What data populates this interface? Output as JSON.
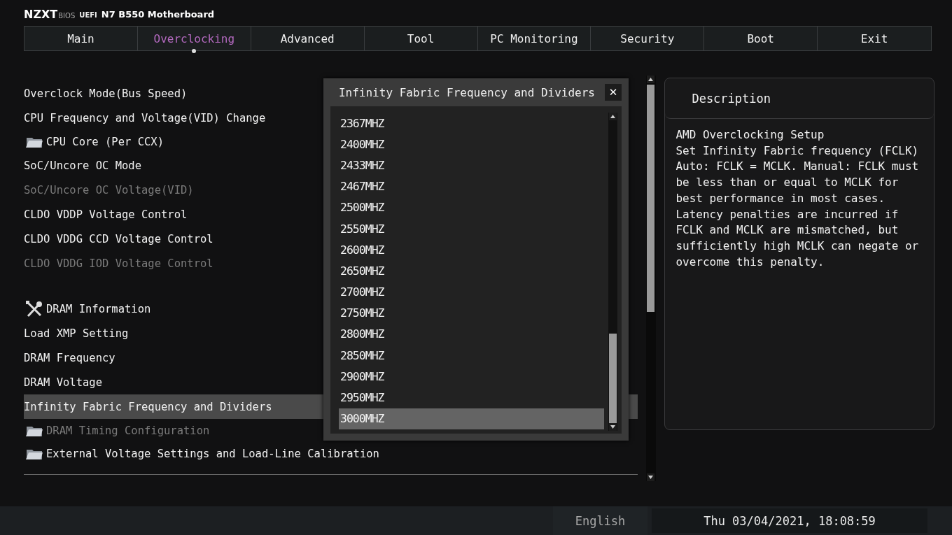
{
  "header": {
    "brand": "NZXT",
    "brand_suffix": "BIOS",
    "firmware": "UEFI",
    "board": "N7 B550 Motherboard"
  },
  "tabs": [
    {
      "label": "Main",
      "selected": false
    },
    {
      "label": "Overclocking",
      "selected": true
    },
    {
      "label": "Advanced",
      "selected": false
    },
    {
      "label": "Tool",
      "selected": false
    },
    {
      "label": "PC Monitoring",
      "selected": false
    },
    {
      "label": "Security",
      "selected": false
    },
    {
      "label": "Boot",
      "selected": false
    },
    {
      "label": "Exit",
      "selected": false
    }
  ],
  "menu": [
    {
      "kind": "item",
      "label": "Overclock Mode(Bus Speed)",
      "disabled": false,
      "selected": false
    },
    {
      "kind": "item",
      "label": "CPU Frequency and Voltage(VID) Change",
      "disabled": false,
      "selected": false
    },
    {
      "kind": "folder",
      "label": "CPU Core (Per CCX)",
      "disabled": false,
      "selected": false
    },
    {
      "kind": "item",
      "label": "SoC/Uncore OC Mode",
      "disabled": false,
      "selected": false
    },
    {
      "kind": "item",
      "label": "SoC/Uncore OC Voltage(VID)",
      "disabled": true,
      "selected": false
    },
    {
      "kind": "item",
      "label": "CLDO VDDP Voltage Control",
      "disabled": false,
      "selected": false
    },
    {
      "kind": "item",
      "label": "CLDO VDDG CCD Voltage Control",
      "disabled": false,
      "selected": false
    },
    {
      "kind": "item",
      "label": "CLDO VDDG IOD Voltage Control",
      "disabled": true,
      "selected": false
    },
    {
      "kind": "section",
      "label": "DRAM Information",
      "disabled": false,
      "selected": false
    },
    {
      "kind": "item",
      "label": "Load XMP Setting",
      "disabled": false,
      "selected": false
    },
    {
      "kind": "item",
      "label": "DRAM Frequency",
      "disabled": false,
      "selected": false
    },
    {
      "kind": "item",
      "label": "DRAM Voltage",
      "disabled": false,
      "selected": false
    },
    {
      "kind": "item",
      "label": "Infinity Fabric Frequency and Dividers",
      "disabled": false,
      "selected": true
    },
    {
      "kind": "folder",
      "label": "DRAM Timing Configuration",
      "disabled": true,
      "selected": false
    },
    {
      "kind": "folder",
      "label": "External Voltage Settings and Load-Line Calibration",
      "disabled": false,
      "selected": false
    }
  ],
  "dialog": {
    "title": "Infinity Fabric Frequency and Dividers",
    "close": "✕",
    "options": [
      {
        "label": "2367MHZ",
        "selected": false
      },
      {
        "label": "2400MHZ",
        "selected": false
      },
      {
        "label": "2433MHZ",
        "selected": false
      },
      {
        "label": "2467MHZ",
        "selected": false
      },
      {
        "label": "2500MHZ",
        "selected": false
      },
      {
        "label": "2550MHZ",
        "selected": false
      },
      {
        "label": "2600MHZ",
        "selected": false
      },
      {
        "label": "2650MHZ",
        "selected": false
      },
      {
        "label": "2700MHZ",
        "selected": false
      },
      {
        "label": "2750MHZ",
        "selected": false
      },
      {
        "label": "2800MHZ",
        "selected": false
      },
      {
        "label": "2850MHZ",
        "selected": false
      },
      {
        "label": "2900MHZ",
        "selected": false
      },
      {
        "label": "2950MHZ",
        "selected": false
      },
      {
        "label": "3000MHZ",
        "selected": true
      }
    ]
  },
  "description": {
    "title": "Description",
    "text": "AMD Overclocking Setup\nSet Infinity Fabric frequency (FCLK)\nAuto: FCLK = MCLK. Manual: FCLK must\nbe less than or equal to MCLK for\nbest performance in most cases.\nLatency penalties are incurred if\nFCLK and MCLK are mismatched, but\nsufficiently high MCLK can negate or\novercome this penalty."
  },
  "status_bar": {
    "language": "English",
    "datetime": "Thu 03/04/2021, 18:08:59"
  }
}
